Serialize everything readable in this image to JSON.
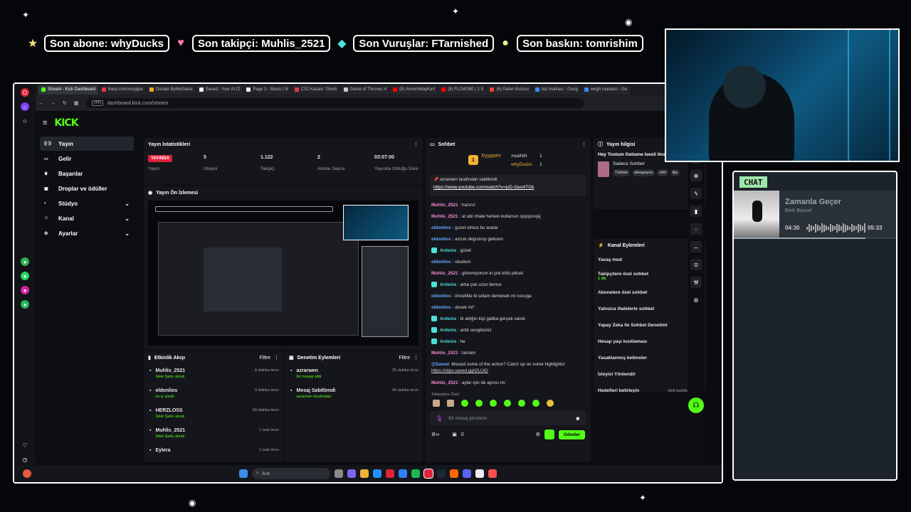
{
  "overlay": {
    "ticker": [
      {
        "icon": "star-icon",
        "color": "#f5e27a",
        "text": "Son abone: whyDucks"
      },
      {
        "icon": "heart-icon",
        "color": "#ff7ab8",
        "text": "Son takipçi: Muhlis_2521"
      },
      {
        "icon": "diamond-icon",
        "color": "#4ee0d8",
        "text": "Son Vuruşlar: FTarnished"
      },
      {
        "icon": "circle-icon",
        "color": "#e6f08a",
        "text": "Son baskın: tomrishim"
      }
    ]
  },
  "browser": {
    "tabs": [
      {
        "label": "Stream - Kick Dashboard",
        "color": "#53fc18",
        "active": true
      },
      {
        "label": "blerp.com/x/xyppe",
        "color": "#e23a3a"
      },
      {
        "label": "Donate ByNoGame",
        "color": "#f5a623"
      },
      {
        "label": "Saved - Your AI Cl",
        "color": "#eeeeee"
      },
      {
        "label": "Page 3 - Music | N",
        "color": "#eeeeee"
      },
      {
        "label": "CS2 Kasası \"Glock",
        "color": "#e23a3a"
      },
      {
        "label": "Game of Thrones 4",
        "color": "#cccccc"
      },
      {
        "label": "(8) AnnemMayKart",
        "color": "#ff0000"
      },
      {
        "label": "(8) FLOW360 | 1.S",
        "color": "#ff0000"
      },
      {
        "label": "(6) Gelen Kutusu",
        "color": "#ea4335"
      },
      {
        "label": "bal markası - Goog",
        "color": "#4285f4"
      },
      {
        "label": "wegh maskesi - Go",
        "color": "#4285f4"
      }
    ],
    "url": "dashboard.kick.com/stream",
    "vpn_label": "VPN"
  },
  "kick": {
    "logo": "KICK",
    "nav": [
      {
        "label": "Yayın",
        "icon": "broadcast-icon",
        "selected": true
      },
      {
        "label": "Gelir",
        "icon": "wallet-icon"
      },
      {
        "label": "Başarılar",
        "icon": "trophy-icon"
      },
      {
        "label": "Droplar ve ödüller",
        "icon": "gift-icon"
      },
      {
        "label": "Stüdyo",
        "icon": "studio-icon",
        "chevron": true
      },
      {
        "label": "Kanal",
        "icon": "user-icon",
        "chevron": true
      },
      {
        "label": "Ayarlar",
        "icon": "gear-icon",
        "chevron": true
      }
    ],
    "stats": {
      "title": "Yayın İstatistikleri",
      "live_badge": "YAYINDA",
      "items": [
        {
          "value": "",
          "label": "Yayın"
        },
        {
          "value": "5",
          "label": "İzleyici"
        },
        {
          "value": "1.122",
          "label": "Takipçi"
        },
        {
          "value": "2",
          "label": "Abone Sayısı"
        },
        {
          "value": "03:07:00",
          "label": "Yayında Olduğu Süre"
        }
      ]
    },
    "preview": {
      "title": "Yayın Ön İzlemesi"
    },
    "activity": {
      "title": "Etkinlik Akışı",
      "filter": "Filtre",
      "rows": [
        {
          "user": "Muhlis_2521",
          "sub": "İstek Şarkı alındı",
          "time": "8 dakika önce"
        },
        {
          "user": "eldonlios",
          "sub": "su iç alındı",
          "time": "9 dakika önce"
        },
        {
          "user": "HERZLOSS",
          "sub": "İstek Şarkı alındı",
          "time": "50 dakika önce"
        },
        {
          "user": "Muhlis_2521",
          "sub": "İstek Şarkı alındı",
          "time": "1 saat önce"
        },
        {
          "user": "Eylera",
          "sub": "",
          "time": "1 saat önce"
        }
      ]
    },
    "audit": {
      "title": "Denetim Eylemleri",
      "filter": "Filtre",
      "rows": [
        {
          "user": "azrarwen",
          "sub": "bir mesajı sildi",
          "time": "35 dakika önce"
        },
        {
          "user": "Mesaj Sabitlendi",
          "sub": "azrarwen tarafından",
          "time": "40 dakika önce"
        }
      ]
    },
    "chat": {
      "title": "Sohbet",
      "top": [
        {
          "rank": "1",
          "name": "Xyypperr",
          "count": ""
        },
        {
          "rank": "",
          "name": "zwaiNN",
          "count": "1"
        },
        {
          "rank": "",
          "name": "whyDucks",
          "count": "1"
        }
      ],
      "pinned_by": "azrarwen tarafından sabitlendi",
      "pinned_link": "https://www.youtube.com/watch?v=jvD-Geo4TGk",
      "messages": [
        {
          "user": "Muhlis_2521",
          "color": "#f58bd6",
          "text": ": hazırız"
        },
        {
          "user": "Muhlis_2521",
          "color": "#f58bd6",
          "text": ": at abi chate herkes kullansın sjsjsjsssjsj"
        },
        {
          "user": "eldonlios",
          "color": "#6aa8ff",
          "text": ": guzel olmus bu arada"
        },
        {
          "user": "eldonlios",
          "color": "#6aa8ff",
          "text": ": azıcık degıstırıp gelicem"
        },
        {
          "user": "Ardexis",
          "color": "#4ee0d8",
          "text": ": güzel"
        },
        {
          "user": "eldonlios",
          "color": "#6aa8ff",
          "text": ": okudum"
        },
        {
          "user": "Muhlis_2521",
          "color": "#f58bd6",
          "text": ": göremiyorum ki çok kötü piksel"
        },
        {
          "user": "Ardexis",
          "color": "#4ee0d8",
          "text": ": ama çok uzun bence"
        },
        {
          "user": "eldonlios",
          "color": "#6aa8ff",
          "text": ": öncelikle bi selam demesek mi cocuga"
        },
        {
          "user": "eldonlios",
          "color": "#6aa8ff",
          "text": ": desek mi*"
        },
        {
          "user": "Ardexis",
          "color": "#4ee0d8",
          "text": ": bi attığın kişi galiba gerçek sandı"
        },
        {
          "user": "Ardexis",
          "color": "#4ee0d8",
          "text": ": artık sevgilisiniz"
        },
        {
          "user": "Ardexis",
          "color": "#4ee0d8",
          "text": ": he"
        },
        {
          "user": "Muhlis_2521",
          "color": "#f58bd6",
          "text": ": tamam"
        }
      ],
      "bot_user": "@Saved",
      "bot_text": ": Missed some of the action? Catch up on some highlights!",
      "bot_link": "https://clips.saved.gg/i2LUiO",
      "last_user": "Muhlis_2521",
      "last_text": ": aylar için de aynısı mı",
      "followers_label": "Takipçilere Özel",
      "input_placeholder": "Bir mesaj gönderin",
      "points": "0",
      "send_label": "Gönder"
    },
    "info": {
      "title": "Yayın bilgisi",
      "stream_title": "Hey Tostum Gelsene Isesli linsksjv !info",
      "category": "Sadece Sohbet",
      "tags": [
        "Türkish",
        "aileayayını",
        "chill",
        "fps"
      ]
    },
    "channel_actions": {
      "title": "Kanal Eylemleri",
      "rows": [
        {
          "label": "Yavaş mod",
          "type": "arrow"
        },
        {
          "label": "Takipçilere özel sohbet",
          "sub": "1 dk.",
          "type": "arrow"
        },
        {
          "label": "Abonelere özel sohbet",
          "type": "toggle"
        },
        {
          "label": "Yalnızca ifadelerle sohbet",
          "type": "toggle"
        },
        {
          "label": "Yapay Zeka ile Sohbet Denetimi",
          "type": "ext"
        },
        {
          "label": "Hesap yaşı kısıtlaması",
          "type": "arrow"
        },
        {
          "label": "Yasaklanmış kelimeler",
          "type": "arrow"
        },
        {
          "label": "İzleyici Yönlendir",
          "type": "none"
        },
        {
          "label": "Hedefleri belirleyin",
          "type": "arrow",
          "extra": "Aktif hedefler • 1"
        }
      ]
    }
  },
  "taskbar": {
    "search_placeholder": "Ara"
  },
  "chat_overlay": {
    "tag": "CHAT",
    "song_title": "Zamanla Geçer",
    "artist": "Berk Baysal",
    "elapsed": "04:30",
    "duration": "05:33",
    "progress": 0.81
  }
}
